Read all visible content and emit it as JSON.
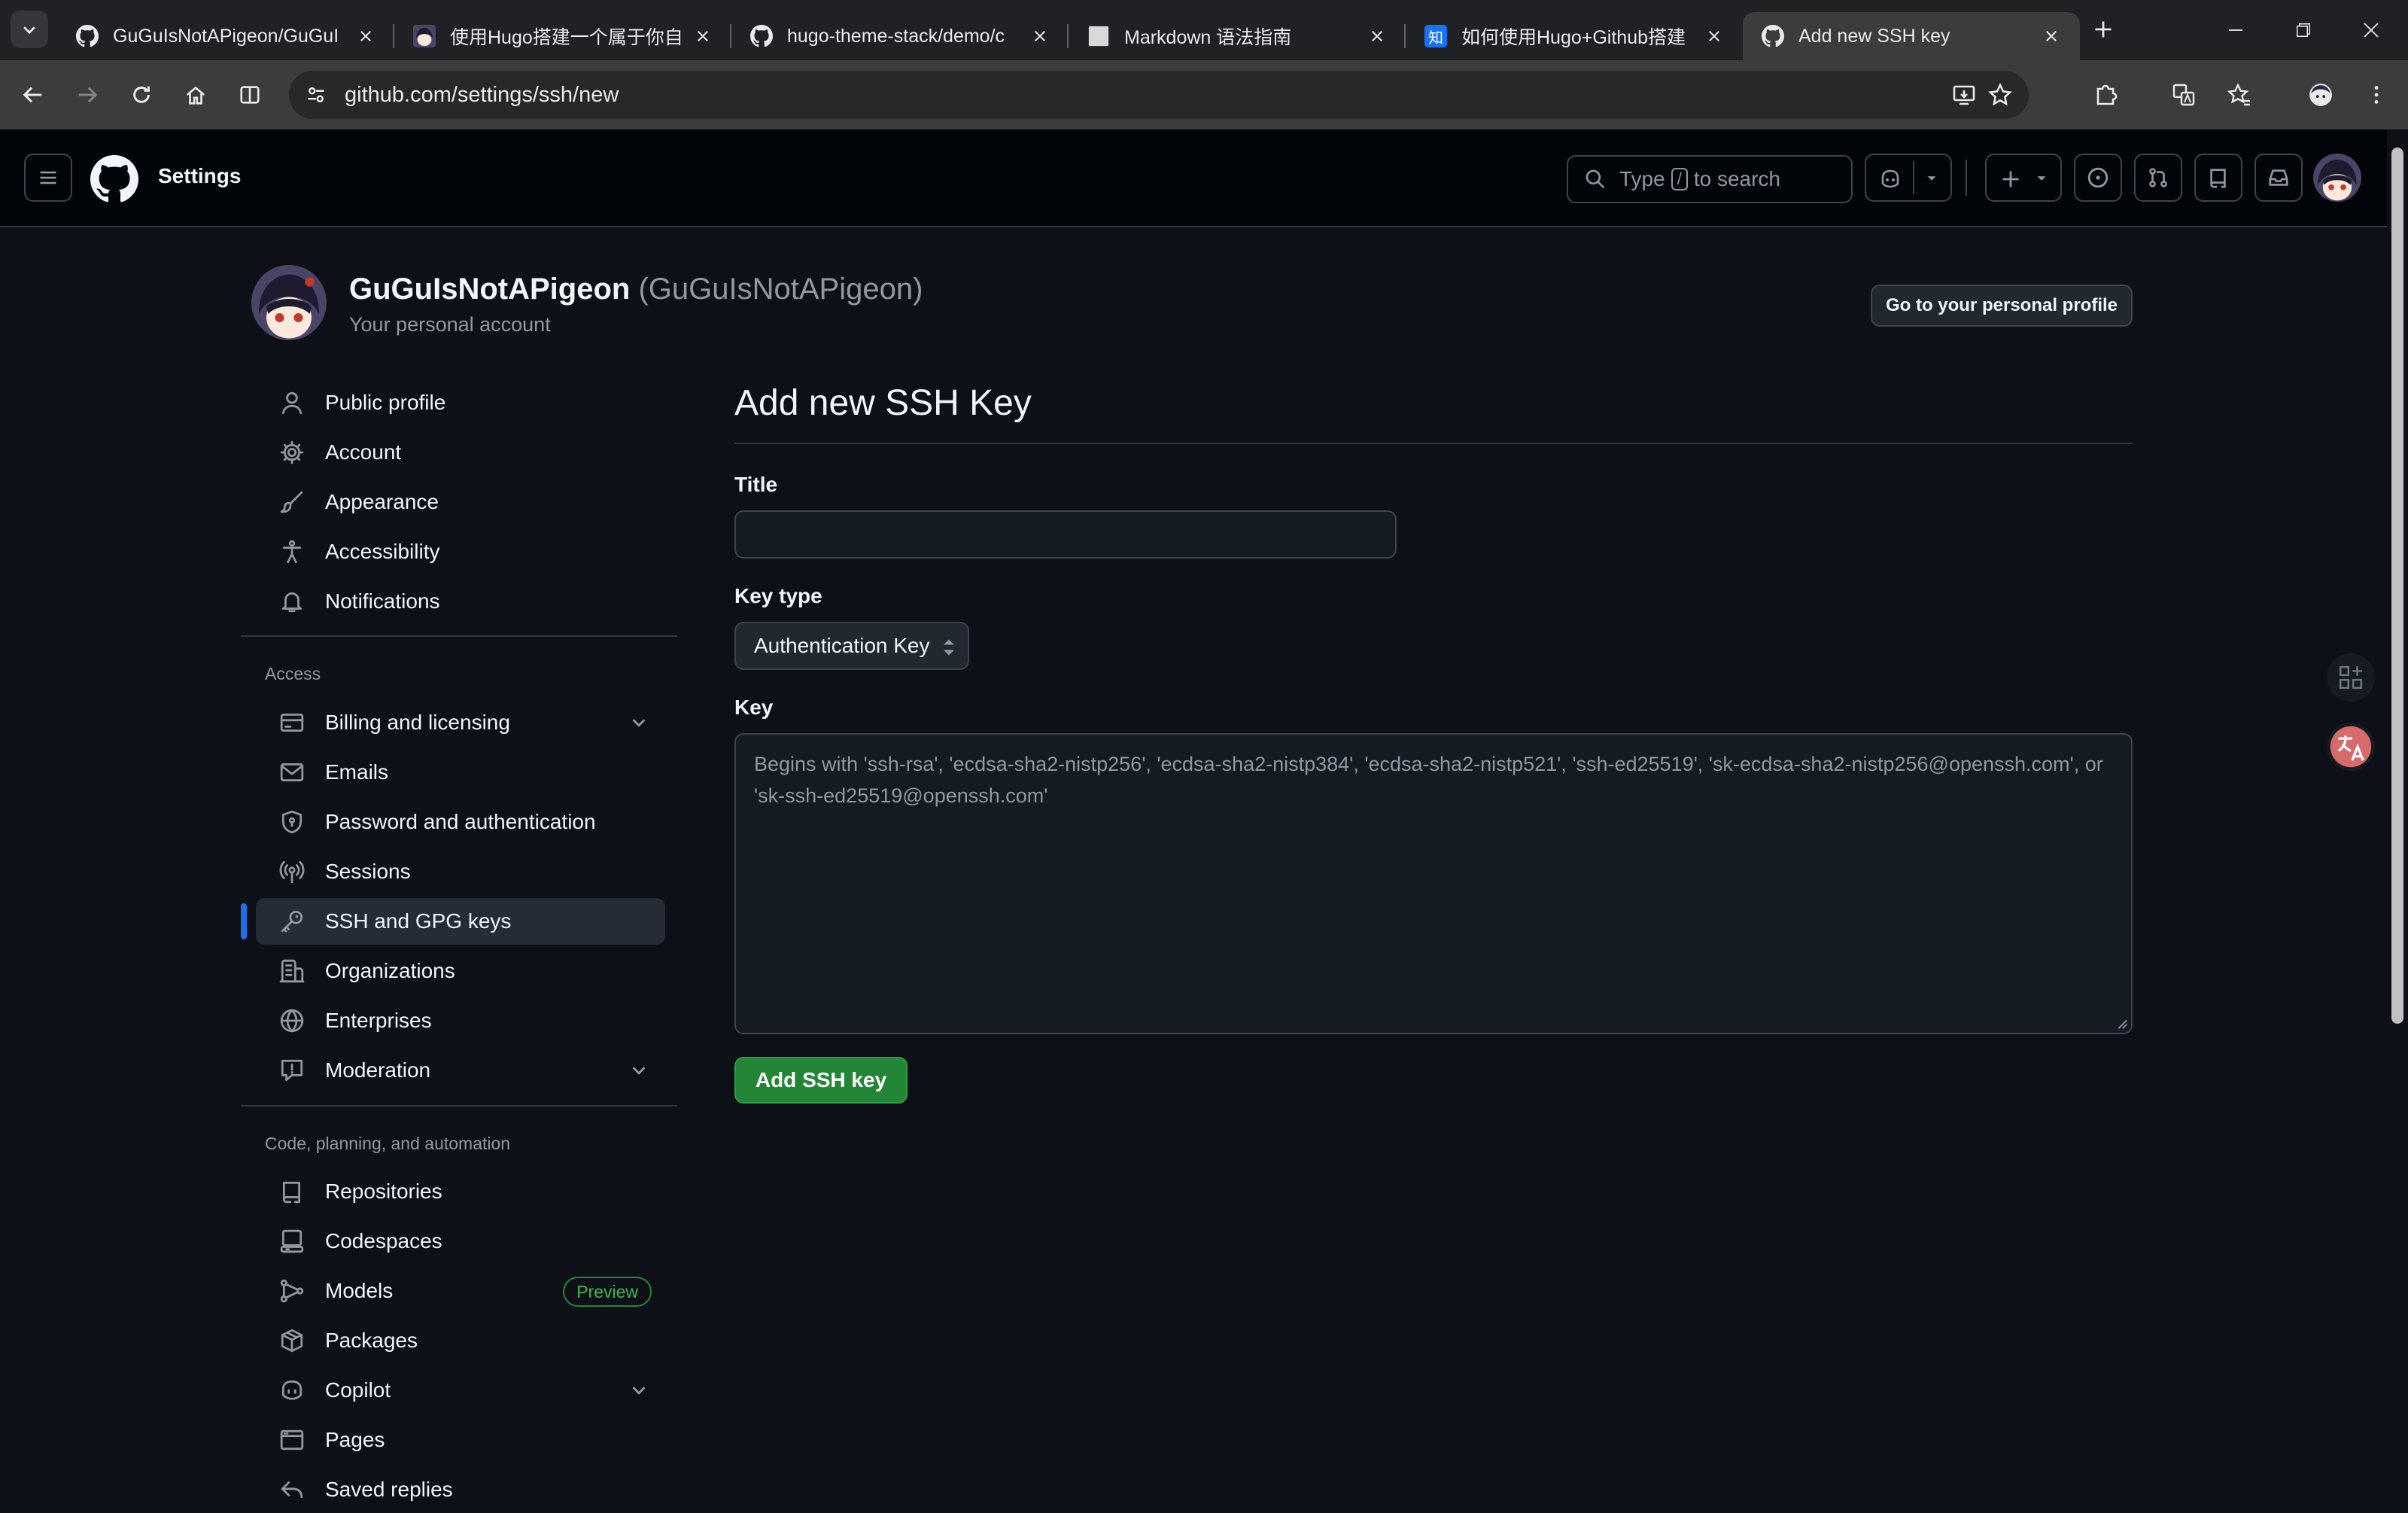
{
  "browser": {
    "tabs": [
      {
        "title": "GuGuIsNotAPigeon/GuGuI",
        "icon": "github-icon",
        "active": false
      },
      {
        "title": "使用Hugo搭建一个属于你自",
        "icon": "avatar-favicon",
        "active": false
      },
      {
        "title": "hugo-theme-stack/demo/c",
        "icon": "github-icon",
        "active": false
      },
      {
        "title": "Markdown 语法指南",
        "icon": "page-icon",
        "active": false
      },
      {
        "title": "如何使用Hugo+Github搭建",
        "icon": "zhihu-icon",
        "active": false
      },
      {
        "title": "Add new SSH key",
        "icon": "github-icon",
        "active": true
      }
    ],
    "zhihu_glyph": "知",
    "url": "github.com/settings/ssh/new"
  },
  "header": {
    "title": "Settings",
    "search_prefix": "Type",
    "search_key": "/",
    "search_suffix": "to search"
  },
  "account": {
    "display_name": "GuGuIsNotAPigeon",
    "handle": "(GuGuIsNotAPigeon)",
    "subtitle": "Your personal account",
    "profile_button": "Go to your personal profile"
  },
  "sidebar": {
    "group1": [
      {
        "label": "Public profile",
        "icon": "person-icon"
      },
      {
        "label": "Account",
        "icon": "gear-icon"
      },
      {
        "label": "Appearance",
        "icon": "paintbrush-icon"
      },
      {
        "label": "Accessibility",
        "icon": "accessibility-icon"
      },
      {
        "label": "Notifications",
        "icon": "bell-icon"
      }
    ],
    "access_heading": "Access",
    "access": [
      {
        "label": "Billing and licensing",
        "icon": "credit-card-icon",
        "expandable": true
      },
      {
        "label": "Emails",
        "icon": "mail-icon"
      },
      {
        "label": "Password and authentication",
        "icon": "shield-lock-icon"
      },
      {
        "label": "Sessions",
        "icon": "broadcast-icon"
      },
      {
        "label": "SSH and GPG keys",
        "icon": "key-icon",
        "selected": true
      },
      {
        "label": "Organizations",
        "icon": "organization-icon"
      },
      {
        "label": "Enterprises",
        "icon": "globe-icon"
      },
      {
        "label": "Moderation",
        "icon": "report-icon",
        "expandable": true
      }
    ],
    "code_heading": "Code, planning, and automation",
    "code": [
      {
        "label": "Repositories",
        "icon": "repo-icon"
      },
      {
        "label": "Codespaces",
        "icon": "codespaces-icon"
      },
      {
        "label": "Models",
        "icon": "models-icon",
        "badge": "Preview"
      },
      {
        "label": "Packages",
        "icon": "package-icon"
      },
      {
        "label": "Copilot",
        "icon": "copilot-icon",
        "expandable": true
      },
      {
        "label": "Pages",
        "icon": "browser-icon"
      },
      {
        "label": "Saved replies",
        "icon": "reply-icon"
      }
    ]
  },
  "form": {
    "heading": "Add new SSH Key",
    "title_label": "Title",
    "title_value": "",
    "key_type_label": "Key type",
    "key_type_value": "Authentication Key",
    "key_label": "Key",
    "key_placeholder": "Begins with 'ssh-rsa', 'ecdsa-sha2-nistp256', 'ecdsa-sha2-nistp384', 'ecdsa-sha2-nistp521', 'ssh-ed25519', 'sk-ecdsa-sha2-nistp256@openssh.com', or 'sk-ssh-ed25519@openssh.com'",
    "submit_label": "Add SSH key"
  },
  "colors": {
    "accent_blue": "#1f6feb",
    "primary_green": "#238636",
    "page_bg": "#0d1117",
    "header_bg": "#010409"
  }
}
